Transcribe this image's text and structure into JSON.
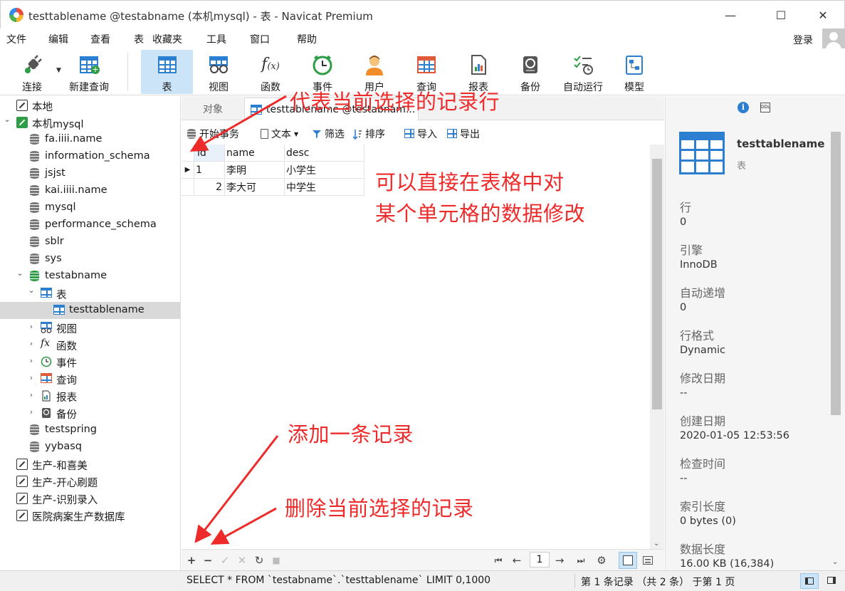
{
  "window": {
    "title": "testtablename @testabname (本机mysql) - 表 - Navicat Premium",
    "controls": {
      "minimize": "—",
      "maximize": "☐",
      "close": "✕"
    }
  },
  "menu": [
    "文件",
    "编辑",
    "查看",
    "表",
    "收藏夹",
    "工具",
    "窗口",
    "帮助"
  ],
  "login_label": "登录",
  "toolbar": [
    {
      "label": "连接",
      "icon": "plug-icon"
    },
    {
      "label": "新建查询",
      "icon": "new-query-icon"
    },
    {
      "label": "表",
      "icon": "table-icon",
      "active": true
    },
    {
      "label": "视图",
      "icon": "view-icon"
    },
    {
      "label": "函数",
      "icon": "function-icon"
    },
    {
      "label": "事件",
      "icon": "clock-icon"
    },
    {
      "label": "用户",
      "icon": "user-icon"
    },
    {
      "label": "查询",
      "icon": "query-icon"
    },
    {
      "label": "报表",
      "icon": "report-icon"
    },
    {
      "label": "备份",
      "icon": "backup-icon"
    },
    {
      "label": "自动运行",
      "icon": "automation-icon"
    },
    {
      "label": "模型",
      "icon": "model-icon"
    }
  ],
  "tree": [
    {
      "label": "本地",
      "level": 0,
      "icon": "connection-off",
      "chevron": ""
    },
    {
      "label": "本机mysql",
      "level": 0,
      "icon": "connection",
      "chevron": "⌄"
    },
    {
      "label": "fa.iiii.name",
      "level": 1,
      "icon": "db"
    },
    {
      "label": "information_schema",
      "level": 1,
      "icon": "db"
    },
    {
      "label": "jsjst",
      "level": 1,
      "icon": "db"
    },
    {
      "label": "kai.iiii.name",
      "level": 1,
      "icon": "db"
    },
    {
      "label": "mysql",
      "level": 1,
      "icon": "db"
    },
    {
      "label": "performance_schema",
      "level": 1,
      "icon": "db"
    },
    {
      "label": "sblr",
      "level": 1,
      "icon": "db"
    },
    {
      "label": "sys",
      "level": 1,
      "icon": "db"
    },
    {
      "label": "testabname",
      "level": 1,
      "icon": "db-green",
      "chevron": "⌄"
    },
    {
      "label": "表",
      "level": 2,
      "icon": "table",
      "chevron": "⌄"
    },
    {
      "label": "testtablename",
      "level": 3,
      "icon": "table",
      "selected": true
    },
    {
      "label": "视图",
      "level": 2,
      "icon": "view",
      "chevron": "›"
    },
    {
      "label": "函数",
      "level": 2,
      "icon": "function",
      "chevron": "›"
    },
    {
      "label": "事件",
      "level": 2,
      "icon": "clock",
      "chevron": "›"
    },
    {
      "label": "查询",
      "level": 2,
      "icon": "query",
      "chevron": "›"
    },
    {
      "label": "报表",
      "level": 2,
      "icon": "report",
      "chevron": "›"
    },
    {
      "label": "备份",
      "level": 2,
      "icon": "backup",
      "chevron": "›"
    },
    {
      "label": "testspring",
      "level": 1,
      "icon": "db"
    },
    {
      "label": "yybasq",
      "level": 1,
      "icon": "db"
    },
    {
      "label": "生产-和喜美",
      "level": 0,
      "icon": "connection-off"
    },
    {
      "label": "生产-开心刷题",
      "level": 0,
      "icon": "connection-off"
    },
    {
      "label": "生产-识别录入",
      "level": 0,
      "icon": "connection-off"
    },
    {
      "label": "医院病案生产数据库",
      "level": 0,
      "icon": "connection-off"
    }
  ],
  "tabs": {
    "objects": "对象",
    "table_tab": "testtablename @testabnam..."
  },
  "subtoolbar": {
    "begin_tx": "开始事务",
    "text": "文本",
    "filter": "筛选",
    "sort": "排序",
    "import": "导入",
    "export": "导出"
  },
  "grid": {
    "columns": [
      "id",
      "name",
      "desc"
    ],
    "rows": [
      {
        "id": "1",
        "name": "李明",
        "desc": "小学生",
        "current": true
      },
      {
        "id": "2",
        "name": "李大可",
        "desc": "中学生",
        "current": false
      }
    ]
  },
  "footer": {
    "add": "+",
    "delete": "−",
    "apply": "✓",
    "discard": "✕",
    "refresh": "↻",
    "stop": "■",
    "page": "1"
  },
  "status": {
    "sql": "SELECT * FROM `testabname`.`testtablename` LIMIT 0,1000",
    "records": "第 1 条记录 （共 2 条） 于第 1 页"
  },
  "info": {
    "name": "testtablename",
    "type": "表",
    "fields": [
      {
        "label": "行",
        "value": "0"
      },
      {
        "label": "引擎",
        "value": "InnoDB"
      },
      {
        "label": "自动递增",
        "value": "0"
      },
      {
        "label": "行格式",
        "value": "Dynamic"
      },
      {
        "label": "修改日期",
        "value": "--"
      },
      {
        "label": "创建日期",
        "value": "2020-01-05 12:53:56"
      },
      {
        "label": "检查时间",
        "value": "--"
      },
      {
        "label": "索引长度",
        "value": "0 bytes (0)"
      },
      {
        "label": "数据长度",
        "value": "16.00 KB (16,384)"
      }
    ]
  },
  "annotations": {
    "current_row": "代表当前选择的记录行",
    "edit_cell_1": "可以直接在表格中对",
    "edit_cell_2": "某个单元格的数据修改",
    "add_record": "添加一条记录",
    "delete_record": "删除当前选择的记录"
  },
  "colors": {
    "accent": "#2c7fd0",
    "annotation": "#ee2b2b",
    "selection": "#cce4f7"
  }
}
